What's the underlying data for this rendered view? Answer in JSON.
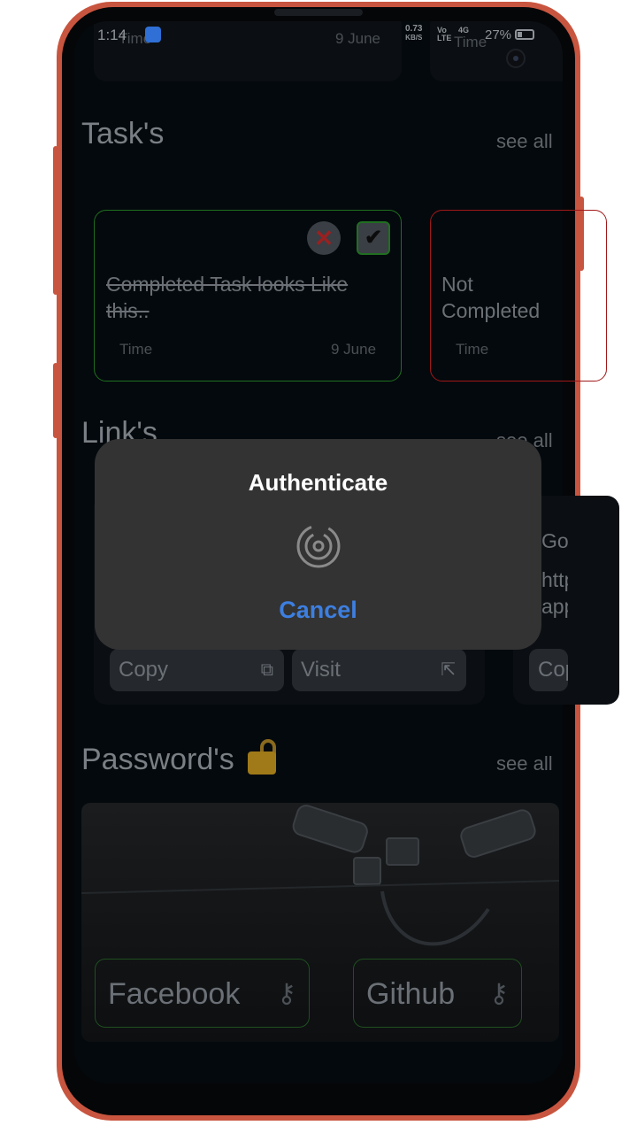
{
  "status_bar": {
    "time": "1:14",
    "net_speed": "0.73",
    "net_unit": "KB/S",
    "volte_top": "Vo",
    "volte_bottom": "LTE",
    "signal": "4G",
    "battery": "27%"
  },
  "top_cards": {
    "left_time": "Time",
    "left_date": "9 June",
    "right_time": "Time"
  },
  "tasks": {
    "title": "Task's",
    "see_all": "see all",
    "completed": {
      "text": "Completed Task looks Like this..",
      "time": "Time",
      "date": "9 June"
    },
    "not_completed": {
      "text": "Not Completed Task looks Like this..",
      "time": "Time"
    }
  },
  "links": {
    "title": "Link's",
    "see_all": "see all",
    "copy_label": "Copy",
    "visit_label": "Visit",
    "second_copy_label": "Copy",
    "second_card_fragment_1": "Gov",
    "second_card_fragment_2": "http",
    "second_card_fragment_3": "app"
  },
  "passwords": {
    "title": "Password's",
    "see_all": "see all",
    "items": [
      "Facebook",
      "Github"
    ]
  },
  "dialog": {
    "title": "Authenticate",
    "cancel": "Cancel",
    "icon": "fingerprint-icon"
  },
  "colors": {
    "frame": "#c8553f",
    "dialog_bg": "#333333",
    "cancel_blue": "#3d7fe0",
    "completed_border": "#1f6f1f",
    "not_completed_border": "#a01818"
  }
}
